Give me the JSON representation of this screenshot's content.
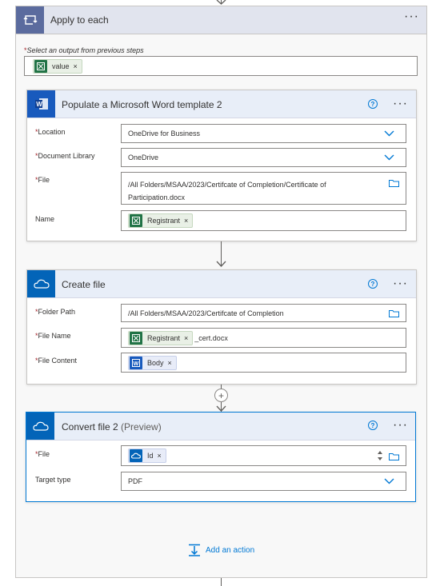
{
  "outer": {
    "title": "Apply to each",
    "select_label": "Select an output from previous steps",
    "select_token": "value",
    "add_action": "Add an action"
  },
  "word": {
    "title": "Populate a Microsoft Word template 2",
    "location_label": "Location",
    "location_value": "OneDrive for Business",
    "library_label": "Document Library",
    "library_value": "OneDrive",
    "file_label": "File",
    "file_value_1": "/All Folders/MSAA/2023/Certifcate of Completion/Certificate of",
    "file_value_2": "Participation.docx",
    "name_label": "Name",
    "name_token": "Registrant"
  },
  "create": {
    "title": "Create file",
    "folder_label": "Folder Path",
    "folder_value": "/All Folders/MSAA/2023/Certifcate of Completion",
    "filename_label": "File Name",
    "filename_token": "Registrant",
    "filename_suffix": "_cert.docx",
    "content_label": "File Content",
    "content_token": "Body"
  },
  "convert": {
    "title": "Convert file 2",
    "preview": "(Preview)",
    "file_label": "File",
    "file_token": "Id",
    "target_label": "Target type",
    "target_value": "PDF"
  },
  "colors": {
    "excel_green": "#217346",
    "word_blue": "#185abd",
    "onedrive_blue": "#0364b8",
    "loop_blue": "#5b6b9e",
    "link_blue": "#0078d4",
    "required_red": "#a4262c"
  }
}
